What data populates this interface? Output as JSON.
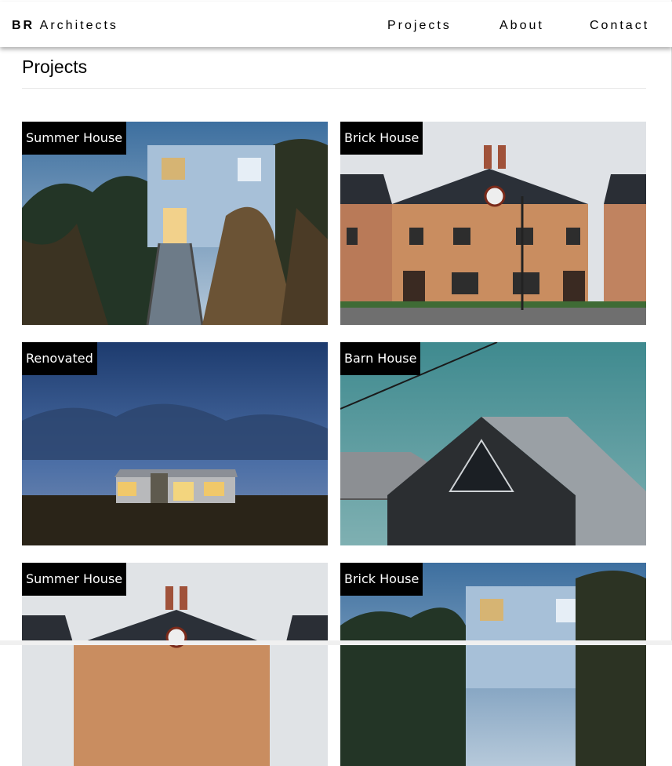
{
  "navbar": {
    "brand_bold": "BR",
    "brand_rest": "Architects",
    "links": [
      "Projects",
      "About",
      "Contact"
    ]
  },
  "page": {
    "title": "Projects"
  },
  "projects": [
    {
      "title": "Summer House",
      "image": "summer-house-boardwalk-photo"
    },
    {
      "title": "Brick House",
      "image": "brick-house-photo"
    },
    {
      "title": "Renovated",
      "image": "renovated-house-at-dusk-photo"
    },
    {
      "title": "Barn House",
      "image": "barn-house-photo"
    },
    {
      "title": "Summer House",
      "image": "brick-house-photo"
    },
    {
      "title": "Brick House",
      "image": "summer-house-boardwalk-photo"
    }
  ],
  "colors": {
    "label_bg": "#000000",
    "label_text": "#ffffff",
    "nav_bg": "#ffffff"
  }
}
